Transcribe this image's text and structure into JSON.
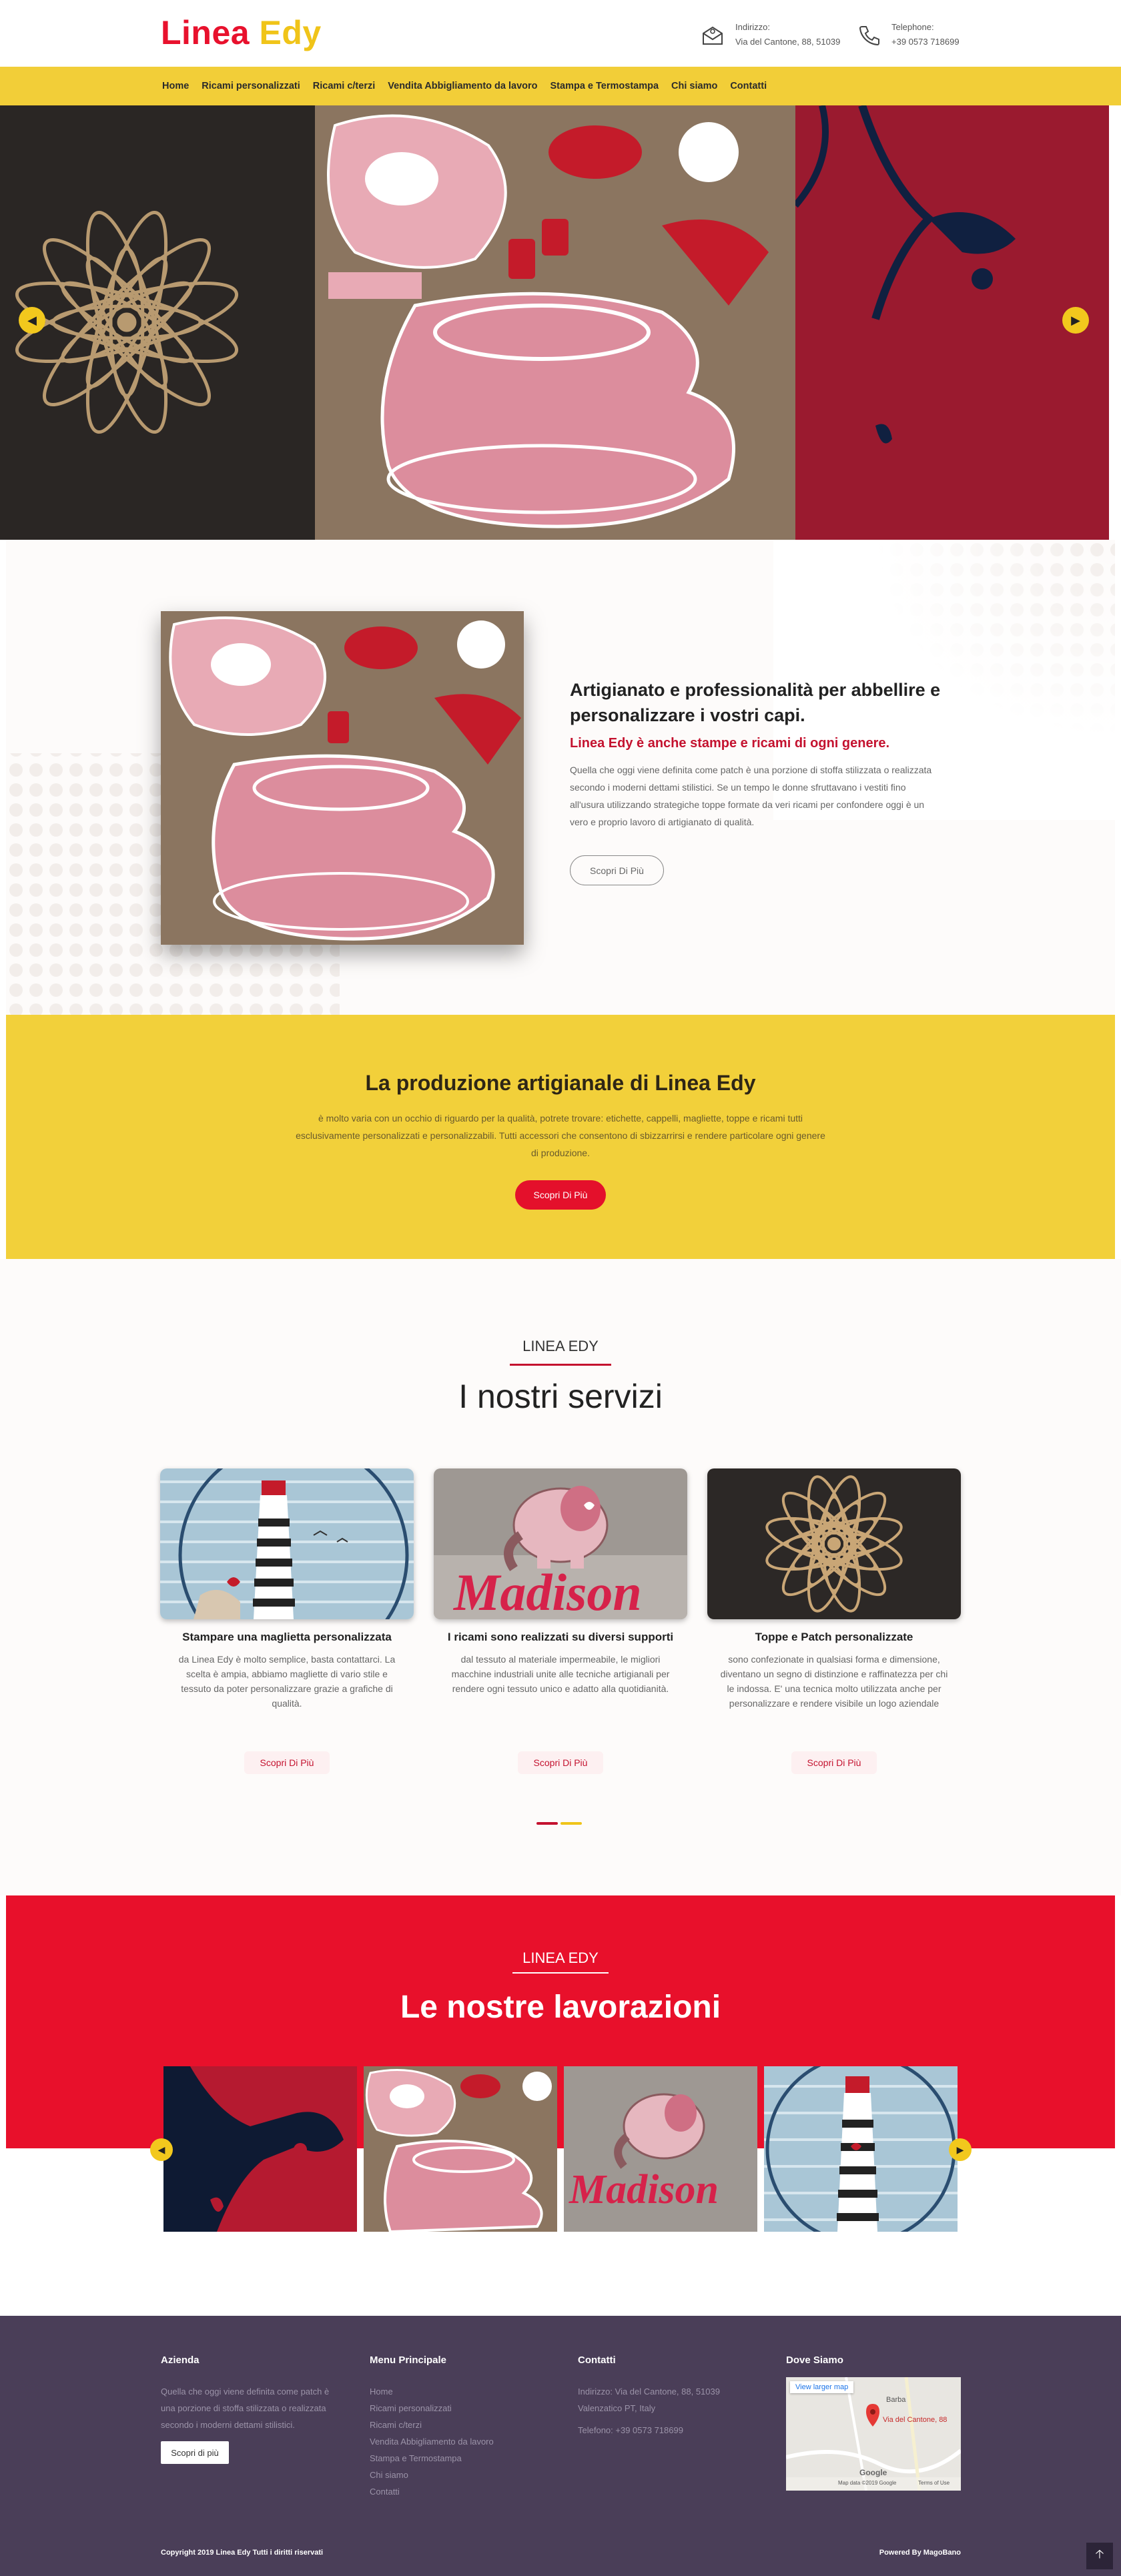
{
  "header": {
    "logo_part1": "Linea",
    "logo_part2": "Edy",
    "address_label": "Indirizzo:",
    "address_value": "Via del Cantone, 88, 51039",
    "phone_label": "Telephone:",
    "phone_value": "+39 0573 718699"
  },
  "nav": {
    "items": [
      "Home",
      "Ricami personalizzati",
      "Ricami c/terzi",
      "Vendita Abbigliamento da lavoro",
      "Stampa e Termostampa",
      "Chi siamo",
      "Contatti"
    ]
  },
  "intro": {
    "title": "Artigianato e professionalità per abbellire e personalizzare i vostri capi.",
    "subtitle": "Linea Edy è anche stampe e ricami di ogni genere.",
    "text": "Quella che oggi viene definita come patch è una porzione di stoffa  stilizzata o realizzata secondo i moderni dettami stilistici. Se un tempo le donne sfruttavano i vestiti fino all'usura utilizzando strategiche toppe formate da veri ricami per confondere oggi è un vero e proprio lavoro di artigianato di qualità.",
    "button": "Scopri Di Più"
  },
  "production": {
    "title": "La produzione artigianale di Linea Edy",
    "text": "è molto varia con un occhio di riguardo per la qualità, potrete trovare: etichette, cappelli, magliette, toppe e ricami tutti esclusivamente personalizzati e personalizzabili. Tutti accessori che consentono di sbizzarrirsi e rendere particolare ogni genere di produzione.",
    "button": "Scopri Di Più"
  },
  "services": {
    "kicker": "LINEA EDY",
    "title": "I nostri servizi",
    "cards": [
      {
        "title": "Stampare una maglietta personalizzata",
        "text": "da Linea Edy è molto semplice, basta contattarci. La scelta è ampia, abbiamo magliette di vario stile e tessuto da poter personalizzare grazie a grafiche di qualità.",
        "button": "Scopri Di Più"
      },
      {
        "title": "I ricami sono realizzati su diversi supporti",
        "text": "dal tessuto al materiale impermeabile, le migliori macchine industriali unite alle tecniche artigianali per rendere ogni tessuto unico e adatto alla quotidianità.",
        "button": "Scopri Di Più"
      },
      {
        "title": "Toppe e Patch personalizzate",
        "text": "sono confezionate  in qualsiasi forma e dimensione, diventano un segno di distinzione e raffinatezza per chi le indossa. E' una tecnica molto utilizzata anche per personalizzare e rendere visibile un logo aziendale",
        "button": "Scopri Di Più"
      }
    ],
    "dot_colors": [
      "#c4122f",
      "#f0c419"
    ]
  },
  "works": {
    "kicker": "LINEA EDY",
    "title": "Le nostre lavorazioni"
  },
  "footer": {
    "col1_title": "Azienda",
    "col1_text": "Quella che oggi viene definita come patch è una porzione di stoffa stilizzata o realizzata secondo i moderni dettami stilistici.",
    "col1_button": "Scopri di più",
    "col2_title": "Menu Principale",
    "col2_items": [
      "Home",
      "Ricami personalizzati",
      "Ricami c/terzi",
      "Vendita Abbigliamento da lavoro",
      "Stampa e Termostampa",
      "Chi siamo",
      "Contatti"
    ],
    "col3_title": "Contatti",
    "col3_address1": "Indirizzo: Via del Cantone, 88, 51039",
    "col3_address2": "Valenzatico PT, Italy",
    "col3_phone": "Telefono: +39 0573 718699",
    "col4_title": "Dove Siamo",
    "map_link": "View larger map",
    "map_place": "Via del Cantone, 88",
    "map_town": "Barba",
    "map_brand": "Google",
    "map_data": "Map data ©2019 Google",
    "map_terms": "Terms of Use",
    "copyright": "Copyright 2019 Linea Edy Tutti i diritti riservati",
    "powered": "Powered By MagoBano"
  },
  "colors": {
    "red": "#e8102b",
    "yellow": "#f2ce38",
    "footer": "#4a3e58"
  },
  "icons": {
    "address": "map-envelope-icon",
    "phone": "phone-icon",
    "prev": "arrow-left-icon",
    "next": "arrow-right-icon",
    "top": "arrow-up-icon"
  }
}
